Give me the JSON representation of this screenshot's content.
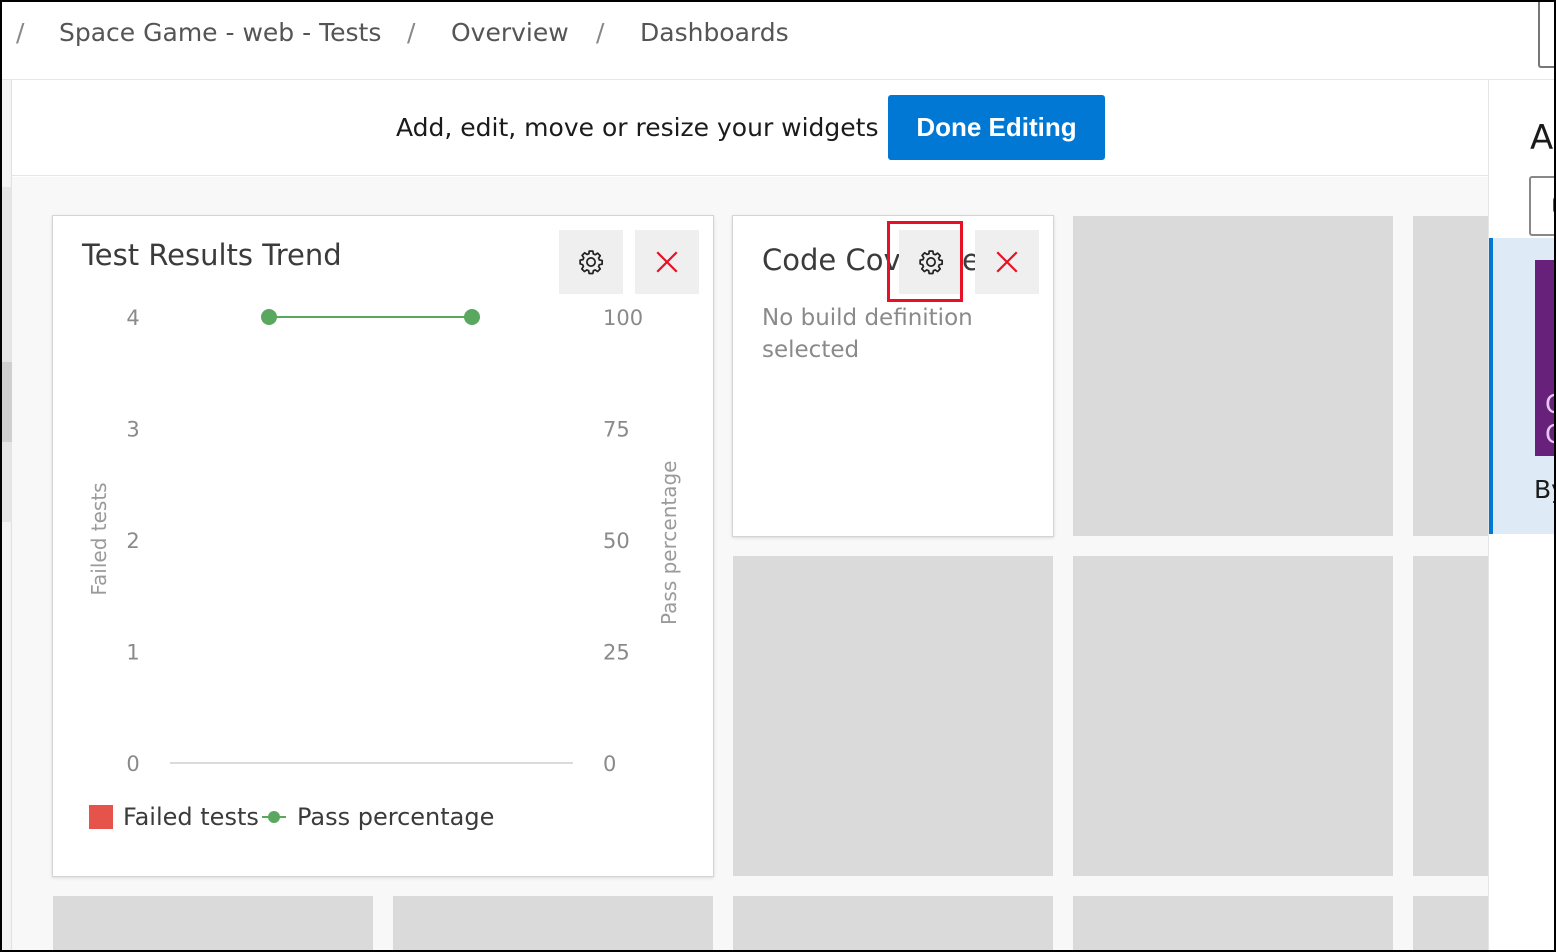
{
  "breadcrumb": {
    "leading_separator": "/",
    "items": [
      "Space Game - web - Tests",
      "Overview",
      "Dashboards"
    ],
    "separators": [
      "/",
      "/"
    ]
  },
  "edit_bar": {
    "message": "Add, edit, move or resize your widgets",
    "done_button": "Done Editing"
  },
  "widgets": {
    "test_results": {
      "title": "Test Results Trend",
      "settings_icon": "gear-icon",
      "remove_icon": "close-icon"
    },
    "code_coverage": {
      "title_visible": "Code Cov",
      "title_tail": "e",
      "message_line1": "No build definition",
      "message_line2": "selected",
      "settings_icon": "gear-icon",
      "remove_icon": "close-icon"
    }
  },
  "chart_data": {
    "type": "line",
    "title": "Test Results Trend",
    "x": [
      1,
      2
    ],
    "y_left": {
      "label": "Failed tests",
      "ticks": [
        "0",
        "1",
        "2",
        "3",
        "4"
      ],
      "range": [
        0,
        4
      ]
    },
    "y_right": {
      "label": "Pass percentage",
      "ticks": [
        "0",
        "25",
        "50",
        "75",
        "100"
      ],
      "range": [
        0,
        100
      ]
    },
    "series": [
      {
        "name": "Failed tests",
        "type": "bar",
        "axis": "left",
        "values": [
          0,
          0
        ],
        "color": "#e5534b"
      },
      {
        "name": "Pass percentage",
        "type": "line",
        "axis": "right",
        "values": [
          100,
          100
        ],
        "color": "#5aa85f"
      }
    ],
    "legend": {
      "position": "bottom-left",
      "items": [
        "Failed tests",
        "Pass percentage"
      ]
    },
    "grid": false
  },
  "right_panel": {
    "title": "Ad",
    "card_text": "By",
    "thumb_text": "C\nC"
  },
  "colors": {
    "accent": "#0078d4",
    "highlight": "#e81123",
    "failed": "#e5534b",
    "pass": "#5aa85f",
    "placeholder": "#dadada"
  }
}
